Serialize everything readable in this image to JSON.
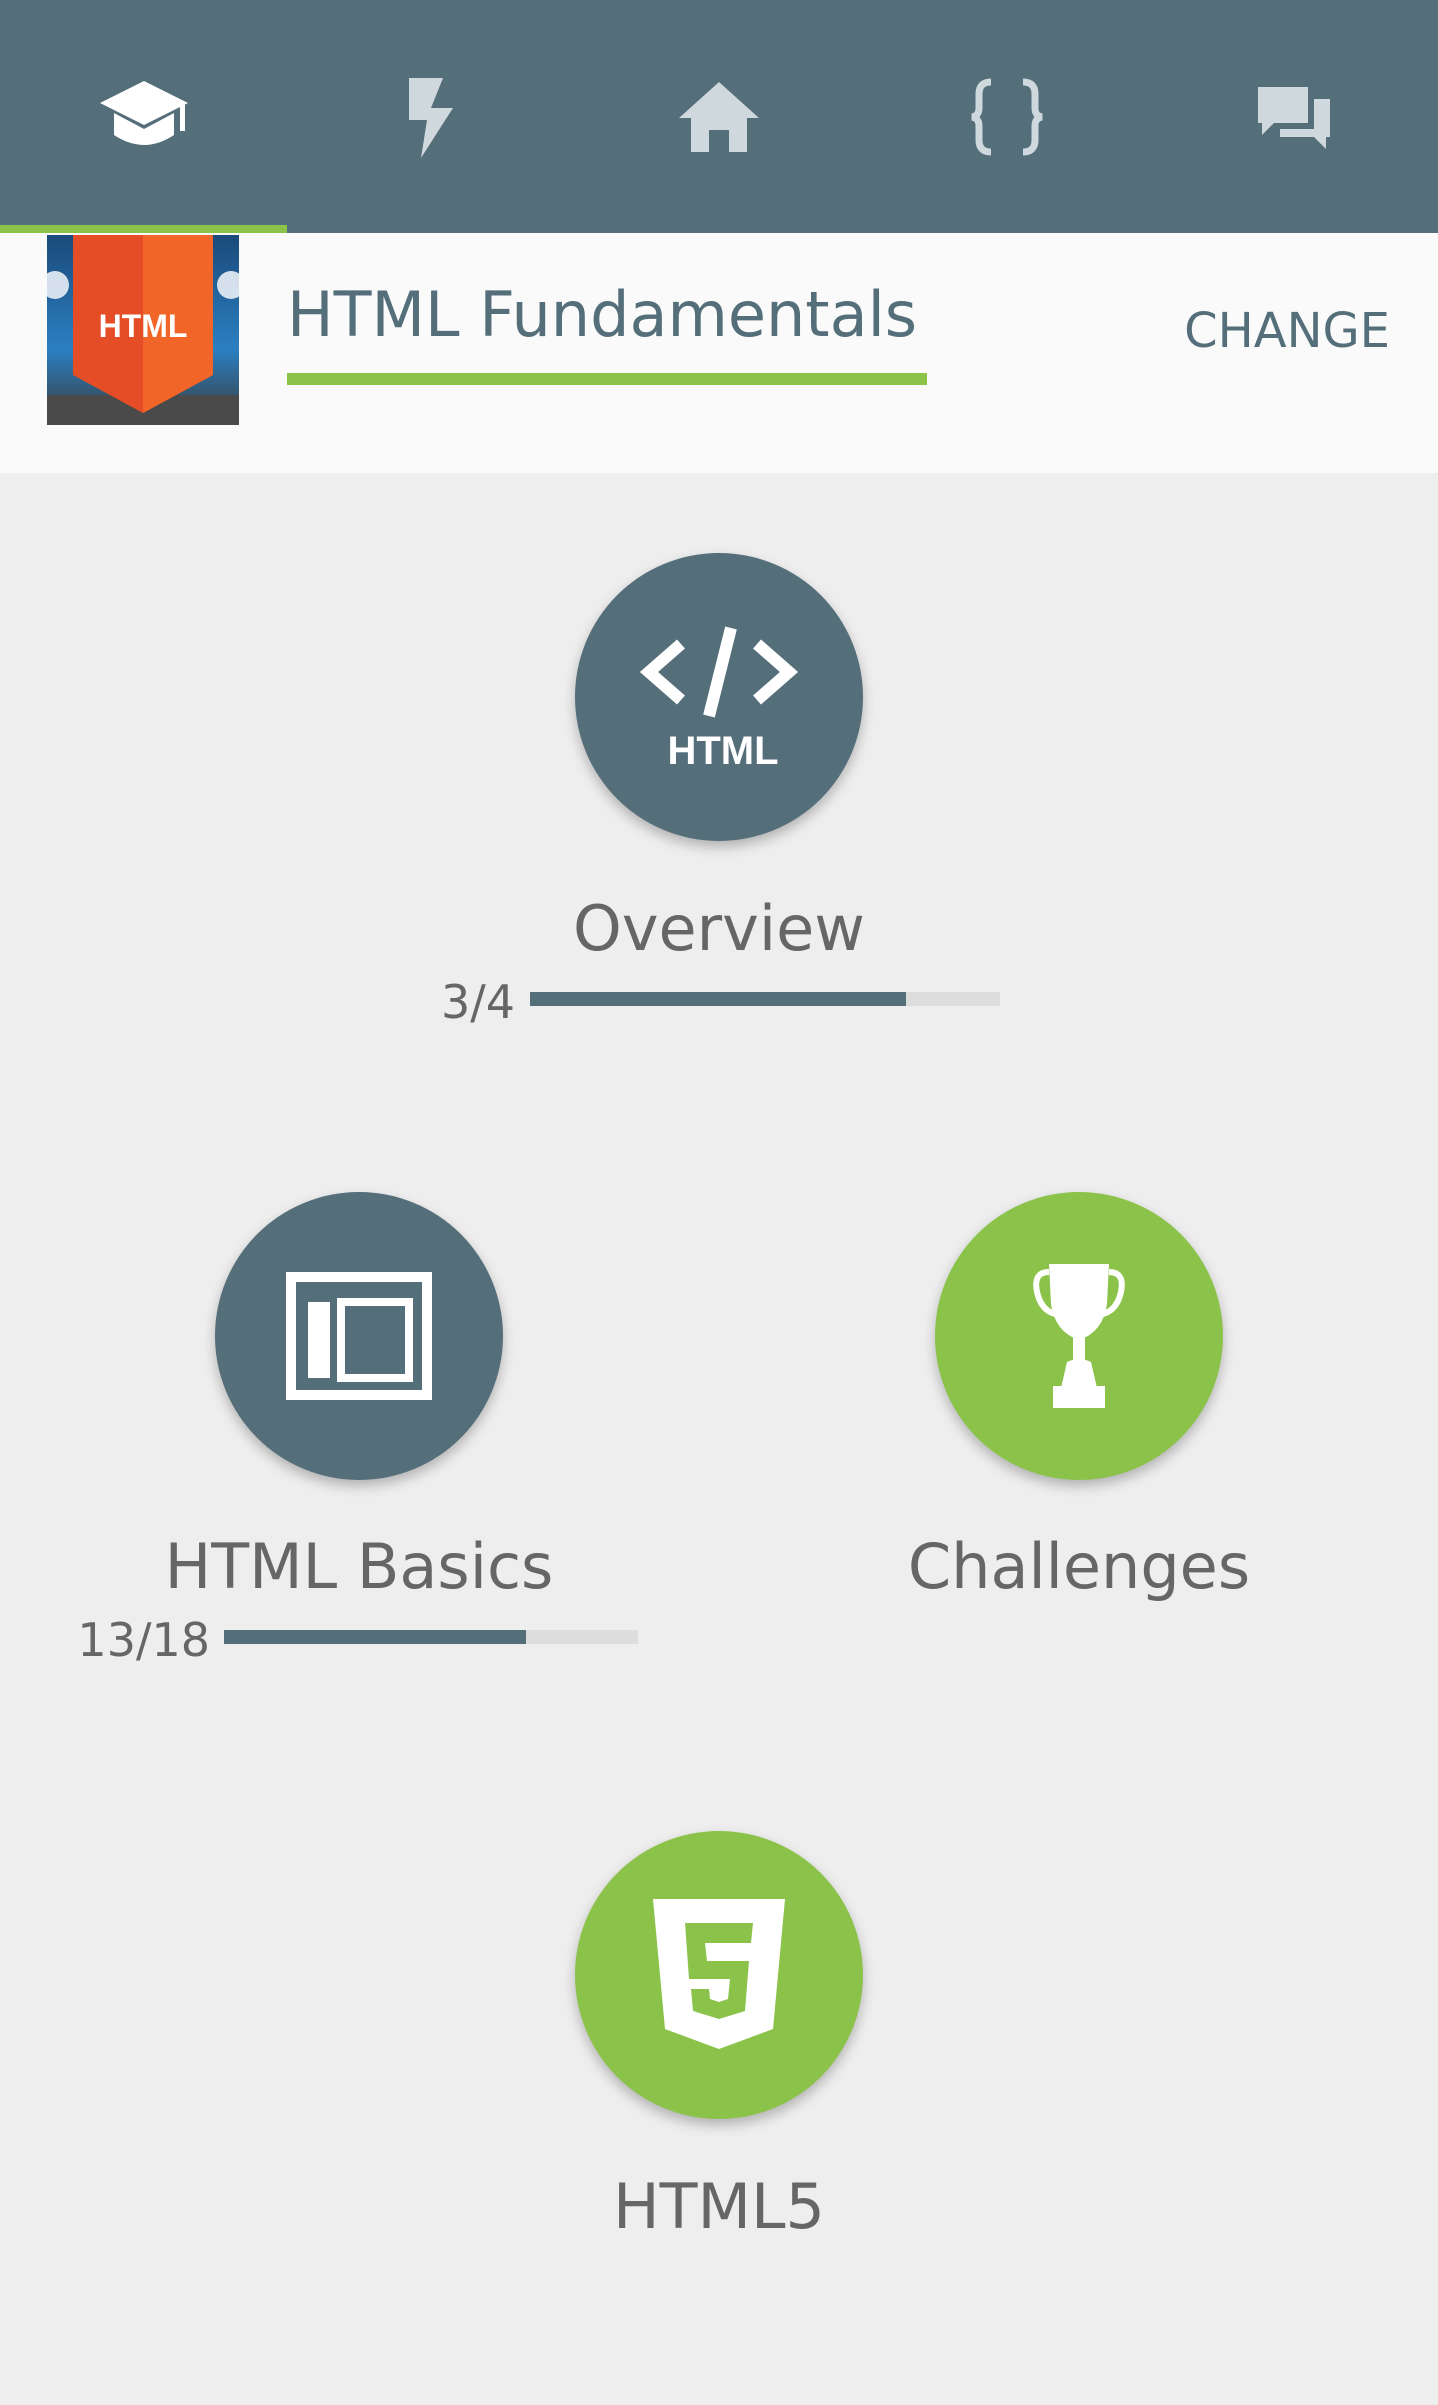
{
  "tabs": [
    {
      "icon": "graduation-cap-icon"
    },
    {
      "icon": "lightning-icon"
    },
    {
      "icon": "home-icon"
    },
    {
      "icon": "code-braces-icon"
    },
    {
      "icon": "chat-icon"
    }
  ],
  "course": {
    "thumbnail_text": "HTML",
    "title": "HTML Fundamentals",
    "change_label": "CHANGE"
  },
  "modules": {
    "overview": {
      "label": "Overview",
      "icon_text": "HTML",
      "progress_text": "3/4",
      "progress_fraction": 0.8
    },
    "html_basics": {
      "label": "HTML Basics",
      "progress_text": "13/18",
      "progress_fraction": 0.73
    },
    "challenges": {
      "label": "Challenges"
    },
    "html5": {
      "label": "HTML5"
    }
  },
  "colors": {
    "primary": "#546e7a",
    "accent": "#8bc34a",
    "background": "#eeeeee"
  }
}
